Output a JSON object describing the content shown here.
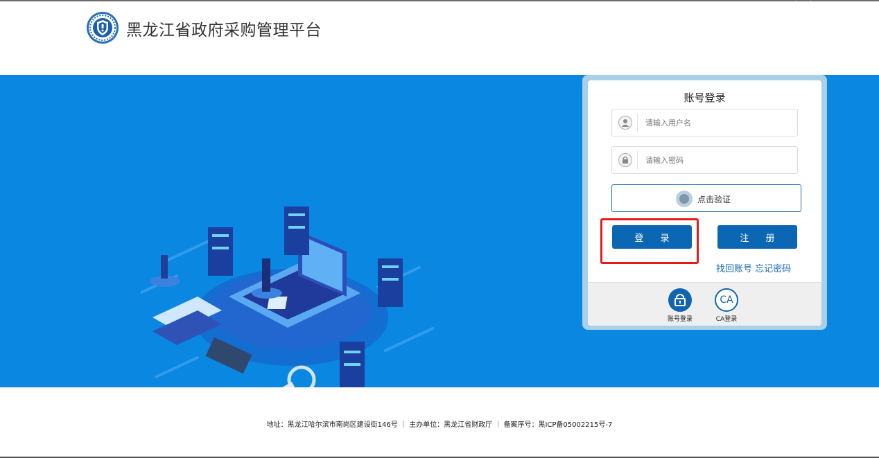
{
  "header": {
    "site_title": "黑龙江省政府采购管理平台",
    "logo": "emblem-logo"
  },
  "login": {
    "title": "账号登录",
    "username": {
      "value": "",
      "placeholder": "请输入用户名",
      "icon": "user-icon"
    },
    "password": {
      "value": "",
      "placeholder": "请输入密码",
      "icon": "lock-icon"
    },
    "verify_label": "点击验证",
    "login_button": "登 录",
    "register_button": "注 册",
    "find_account_link": "找回账号",
    "forgot_password_link": "忘记密码",
    "modes": [
      {
        "label": "账号登录",
        "icon": "lock-icon"
      },
      {
        "label": "CA登录",
        "icon": "ca-icon",
        "glyph": "CA"
      }
    ]
  },
  "footer": {
    "text": "地址：黑龙江哈尔滨市南岗区建设街146号 ｜ 主办单位：黑龙江省财政厅 ｜ 备案序号：黑ICP备05002215号-7"
  },
  "colors": {
    "banner": "#0a87e0",
    "primary": "#0b67b3",
    "highlight": "#e51a1a",
    "link": "#1569b4"
  }
}
